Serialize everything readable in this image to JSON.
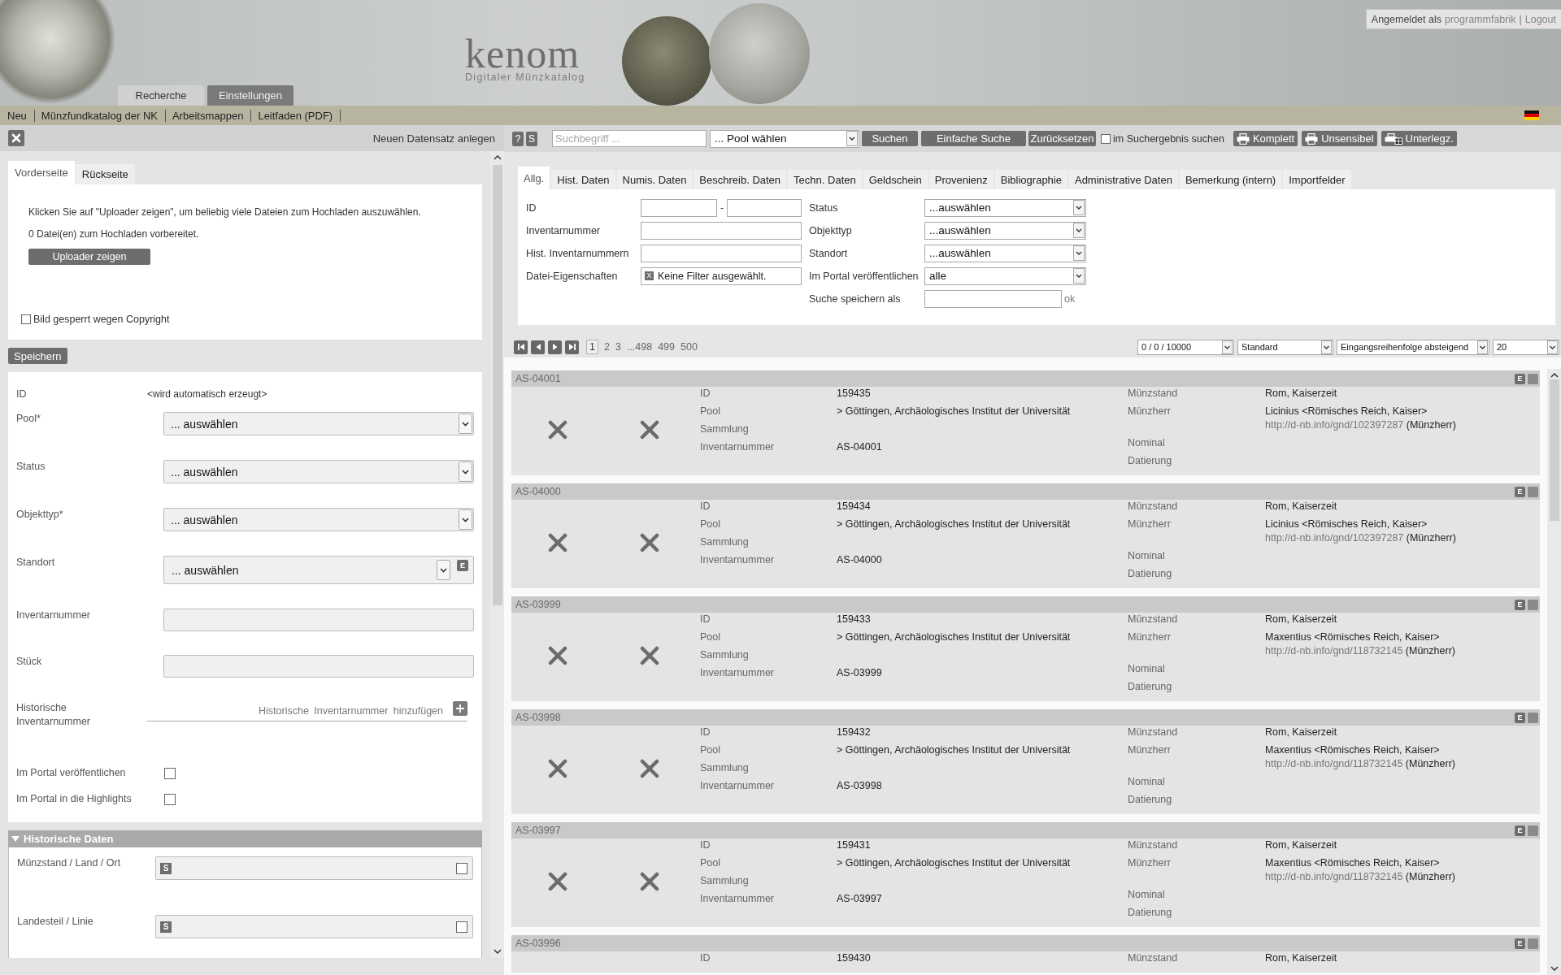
{
  "header": {
    "logo": {
      "title": "kenom",
      "subtitle": "Digitaler Münzkatalog"
    },
    "tabs": [
      {
        "label": "Recherche",
        "selected": true
      },
      {
        "label": "Einstellungen",
        "selected": false
      }
    ],
    "login": {
      "label": "Angemeldet als",
      "user": "programmfabrik",
      "separator": "|",
      "logout": "Logout"
    }
  },
  "menu": {
    "items": [
      "Neu",
      "Münzfundkatalog der NK",
      "Arbeitsmappen",
      "Leitfaden (PDF)"
    ]
  },
  "editor": {
    "title": "Neuen Datensatz anlegen",
    "image_tabs": [
      {
        "label": "Vorderseite",
        "selected": true
      },
      {
        "label": "Rückseite",
        "selected": false
      }
    ],
    "upload_hint": "Klicken Sie auf \"Uploader zeigen\", um beliebig viele Dateien zum Hochladen auszuwählen.",
    "upload_status": "0 Datei(en) zum Hochladen vorbereitet.",
    "upload_button": "Uploader zeigen",
    "copyright": {
      "label": "Bild gesperrt wegen Copyright",
      "checked": false
    },
    "save_button": "Speichern",
    "fields": [
      {
        "kind": "static",
        "label": "ID",
        "value": "<wird automatisch erzeugt>"
      },
      {
        "kind": "select",
        "label": "Pool*",
        "value": "... auswählen"
      },
      {
        "kind": "select",
        "label": "Status",
        "value": "... auswählen"
      },
      {
        "kind": "select",
        "label": "Objekttyp*",
        "value": "... auswählen"
      },
      {
        "kind": "select_edit",
        "label": "Standort",
        "value": "... auswählen",
        "button": "E"
      },
      {
        "kind": "text",
        "label": "Inventarnummer"
      },
      {
        "kind": "text",
        "label": "Stück"
      },
      {
        "kind": "add",
        "label": "Historische Inventarnummer",
        "action": "Historische Inventarnummer hinzufügen"
      },
      {
        "kind": "checkbox",
        "label": "Im Portal veröffentlichen",
        "checked": false
      },
      {
        "kind": "checkbox",
        "label": "Im Portal in die Highlights",
        "checked": false
      }
    ],
    "section": {
      "title": "Historische Daten",
      "expanded": true,
      "fields": [
        {
          "label": "Münzstand / Land / Ort",
          "button": "S",
          "checked": false
        },
        {
          "label": "Landesteil / Linie",
          "button": "S",
          "checked": false
        }
      ]
    }
  },
  "search": {
    "help_button": "?",
    "s_button": "S",
    "query": {
      "placeholder": "Suchbegriff ..."
    },
    "pool": {
      "value": "... Pool wählen"
    },
    "buttons": [
      "Suchen",
      "Einfache Suche",
      "Zurücksetzen"
    ],
    "within": {
      "label": "im Suchergebnis suchen",
      "checked": false
    },
    "print_buttons": [
      {
        "kind": "printer",
        "label": "Komplett"
      },
      {
        "kind": "printer",
        "label": "Unsensibel"
      },
      {
        "kind": "grid",
        "label": "Unterlegz."
      }
    ]
  },
  "filter": {
    "tabs": [
      {
        "label": "Allg.",
        "selected": true
      },
      {
        "label": "Hist. Daten",
        "selected": false
      },
      {
        "label": "Numis. Daten",
        "selected": false
      },
      {
        "label": "Beschreib. Daten",
        "selected": false
      },
      {
        "label": "Techn. Daten",
        "selected": false
      },
      {
        "label": "Geldschein",
        "selected": false
      },
      {
        "label": "Provenienz",
        "selected": false
      },
      {
        "label": "Bibliographie",
        "selected": false
      },
      {
        "label": "Administrative Daten",
        "selected": false
      },
      {
        "label": "Bemerkung (intern)",
        "selected": false
      },
      {
        "label": "Importfelder",
        "selected": false
      }
    ],
    "left_fields": [
      {
        "kind": "range",
        "label": "ID",
        "separator": "-"
      },
      {
        "kind": "text",
        "label": "Inventarnummer"
      },
      {
        "kind": "text",
        "label": "Hist. Inventarnummern"
      },
      {
        "kind": "chip",
        "label": "Datei-Eigenschaften",
        "chip": "X",
        "value": "Keine Filter ausgewählt."
      }
    ],
    "right_fields": [
      {
        "kind": "select",
        "label": "Status",
        "value": "...auswählen"
      },
      {
        "kind": "select",
        "label": "Objekttyp",
        "value": "...auswählen"
      },
      {
        "kind": "select",
        "label": "Standort",
        "value": "...auswählen"
      },
      {
        "kind": "select",
        "label": "Im Portal veröffentlichen",
        "value": "alle"
      },
      {
        "kind": "save",
        "label": "Suche speichern als",
        "action": "ok"
      }
    ]
  },
  "pagination": {
    "pages": [
      {
        "label": "1",
        "selected": true
      },
      {
        "label": "2",
        "selected": false
      },
      {
        "label": "3",
        "selected": false
      },
      {
        "label": "...498",
        "selected": false
      },
      {
        "label": "499",
        "selected": false
      },
      {
        "label": "500",
        "selected": false
      }
    ],
    "selects": [
      "0 / 0 / 10000",
      "Standard",
      "Eingangsreihenfolge absteigend",
      "20"
    ]
  },
  "results": [
    {
      "number": "AS-04001",
      "edit_button": "E",
      "images": [
        {
          "kind": "missing"
        },
        {
          "kind": "missing"
        }
      ],
      "fields_left": [
        {
          "label": "ID",
          "value": "159435"
        },
        {
          "label": "Pool",
          "value": "> Göttingen, Archäologisches Institut der Universität"
        },
        {
          "label": "Sammlung"
        },
        {
          "label": "Inventarnummer",
          "value": "AS-04001"
        }
      ],
      "fields_right": [
        {
          "label": "Münzstand",
          "value": "Rom, Kaiserzeit"
        },
        {
          "label": "Münzherr",
          "value": "Licinius <Römisches Reich, Kaiser>",
          "link": "http://d-nb.info/gnd/102397287",
          "link_note": "(Münzherr)"
        },
        {
          "label": "Nominal"
        },
        {
          "label": "Datierung"
        }
      ]
    },
    {
      "number": "AS-04000",
      "edit_button": "E",
      "images": [
        {
          "kind": "missing"
        },
        {
          "kind": "missing"
        }
      ],
      "fields_left": [
        {
          "label": "ID",
          "value": "159434"
        },
        {
          "label": "Pool",
          "value": "> Göttingen, Archäologisches Institut der Universität"
        },
        {
          "label": "Sammlung"
        },
        {
          "label": "Inventarnummer",
          "value": "AS-04000"
        }
      ],
      "fields_right": [
        {
          "label": "Münzstand",
          "value": "Rom, Kaiserzeit"
        },
        {
          "label": "Münzherr",
          "value": "Licinius <Römisches Reich, Kaiser>",
          "link": "http://d-nb.info/gnd/102397287",
          "link_note": "(Münzherr)"
        },
        {
          "label": "Nominal"
        },
        {
          "label": "Datierung"
        }
      ]
    },
    {
      "number": "AS-03999",
      "edit_button": "E",
      "images": [
        {
          "kind": "missing"
        },
        {
          "kind": "missing"
        }
      ],
      "fields_left": [
        {
          "label": "ID",
          "value": "159433"
        },
        {
          "label": "Pool",
          "value": "> Göttingen, Archäologisches Institut der Universität"
        },
        {
          "label": "Sammlung"
        },
        {
          "label": "Inventarnummer",
          "value": "AS-03999"
        }
      ],
      "fields_right": [
        {
          "label": "Münzstand",
          "value": "Rom, Kaiserzeit"
        },
        {
          "label": "Münzherr",
          "value": "Maxentius <Römisches Reich, Kaiser>",
          "link": "http://d-nb.info/gnd/118732145",
          "link_note": "(Münzherr)"
        },
        {
          "label": "Nominal"
        },
        {
          "label": "Datierung"
        }
      ]
    },
    {
      "number": "AS-03998",
      "edit_button": "E",
      "images": [
        {
          "kind": "missing"
        },
        {
          "kind": "missing"
        }
      ],
      "fields_left": [
        {
          "label": "ID",
          "value": "159432"
        },
        {
          "label": "Pool",
          "value": "> Göttingen, Archäologisches Institut der Universität"
        },
        {
          "label": "Sammlung"
        },
        {
          "label": "Inventarnummer",
          "value": "AS-03998"
        }
      ],
      "fields_right": [
        {
          "label": "Münzstand",
          "value": "Rom, Kaiserzeit"
        },
        {
          "label": "Münzherr",
          "value": "Maxentius <Römisches Reich, Kaiser>",
          "link": "http://d-nb.info/gnd/118732145",
          "link_note": "(Münzherr)"
        },
        {
          "label": "Nominal"
        },
        {
          "label": "Datierung"
        }
      ]
    },
    {
      "number": "AS-03997",
      "edit_button": "E",
      "images": [
        {
          "kind": "missing"
        },
        {
          "kind": "missing"
        }
      ],
      "fields_left": [
        {
          "label": "ID",
          "value": "159431"
        },
        {
          "label": "Pool",
          "value": "> Göttingen, Archäologisches Institut der Universität"
        },
        {
          "label": "Sammlung"
        },
        {
          "label": "Inventarnummer",
          "value": "AS-03997"
        }
      ],
      "fields_right": [
        {
          "label": "Münzstand",
          "value": "Rom, Kaiserzeit"
        },
        {
          "label": "Münzherr",
          "value": "Maxentius <Römisches Reich, Kaiser>",
          "link": "http://d-nb.info/gnd/118732145",
          "link_note": "(Münzherr)"
        },
        {
          "label": "Nominal"
        },
        {
          "label": "Datierung"
        }
      ]
    },
    {
      "number": "AS-03996",
      "edit_button": "E",
      "fields_left": [
        {
          "label": "ID",
          "value": "159430"
        }
      ],
      "fields_right": [
        {
          "label": "Münzstand",
          "value": "Rom, Kaiserzeit"
        }
      ]
    }
  ]
}
